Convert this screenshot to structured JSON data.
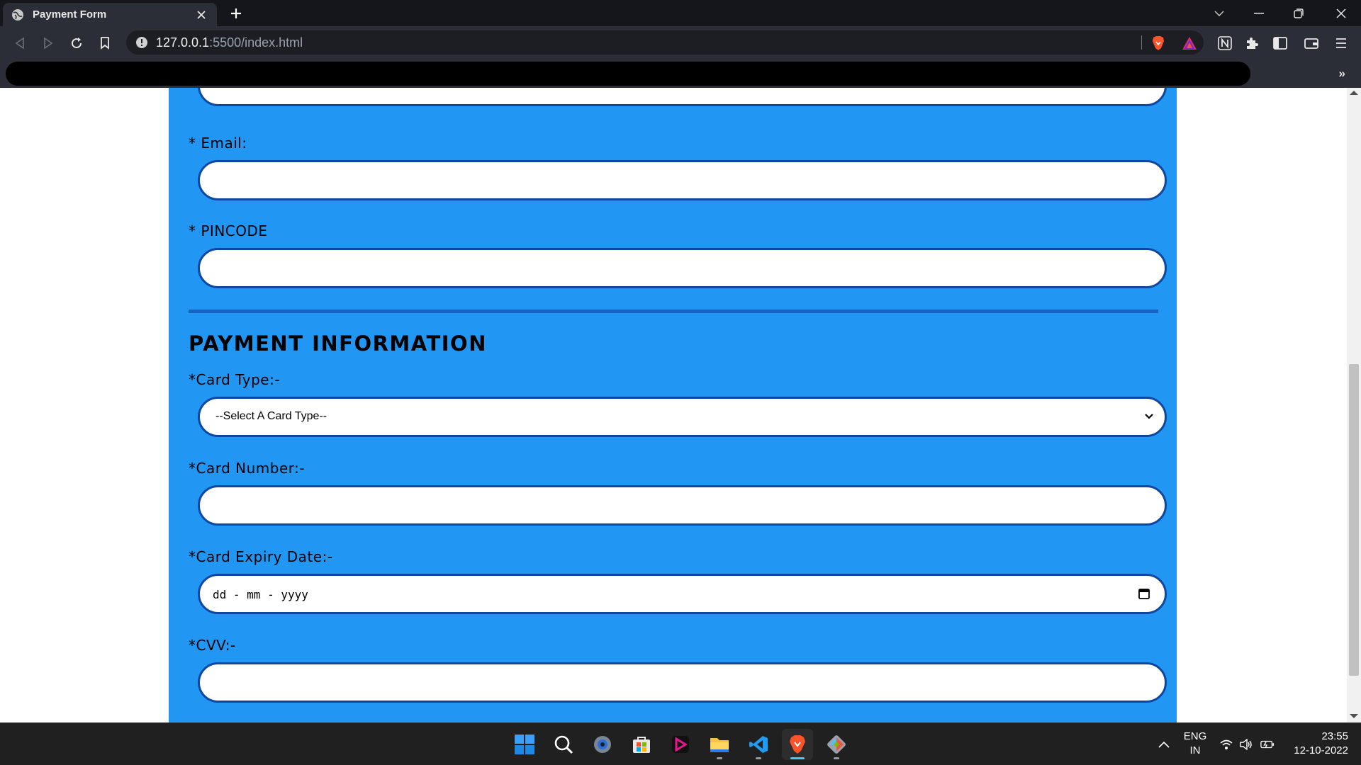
{
  "browser": {
    "tab": {
      "title": "Payment Form"
    },
    "url": {
      "host": "127.0.0.1",
      "path": ":5500/index.html"
    },
    "bookmarks_overflow": "»"
  },
  "form": {
    "email_label": "* Email:",
    "pincode_label": "* PINCODE",
    "section_title": "PAYMENT INFORMATION",
    "card_type_label": "*Card Type:-",
    "card_type_selected": "--Select A Card Type--",
    "card_number_label": "*Card Number:-",
    "card_expiry_label": "*Card Expiry Date:-",
    "card_expiry_placeholder": "dd - mm - yyyy",
    "cvv_label": "*CVV:-",
    "accent_color": "#2196f3",
    "border_color": "#0d47a1"
  },
  "taskbar": {
    "language": "ENG",
    "region": "IN",
    "time": "23:55",
    "date": "12-10-2022",
    "apps": [
      "start-icon",
      "search-icon",
      "settings-icon",
      "store-icon",
      "media-app-icon",
      "file-explorer-icon",
      "vscode-icon",
      "brave-icon",
      "git-icon"
    ]
  }
}
